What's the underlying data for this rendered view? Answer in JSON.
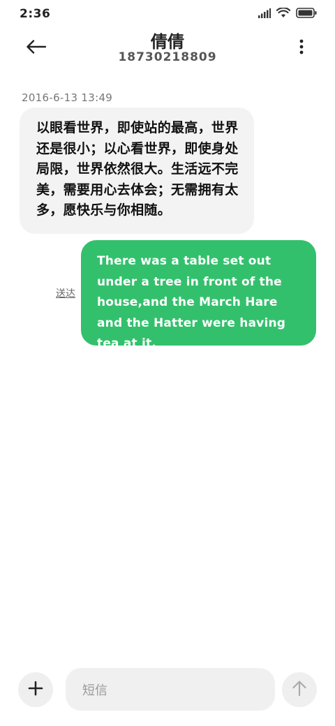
{
  "status_bar": {
    "time": "2:36",
    "icons": [
      "signal-icon",
      "wifi-icon",
      "battery-icon"
    ]
  },
  "header": {
    "contact_name": "倩倩",
    "contact_number": "18730218809",
    "back_icon": "back-arrow-icon",
    "more_icon": "more-vertical-icon"
  },
  "conversation": {
    "timestamp": "2016-6-13 13:49",
    "incoming_message": "以眼看世界，即使站的最高，世界还是很小；以心看世界，即使身处局限，世界依然很大。生活远不完美，需要用心去体会；无需拥有太多，愿快乐与你相随。",
    "outgoing_message": "There was a table set out under a tree in front of the house,and the March Hare and the Hatter were having tea at it.",
    "outgoing_status": "送达"
  },
  "input_bar": {
    "placeholder": "短信",
    "add_icon": "plus-icon",
    "send_icon": "arrow-up-icon"
  },
  "colors": {
    "outgoing_bubble": "#33c06c",
    "incoming_bubble": "#f3f3f3",
    "background": "#ffffff"
  }
}
